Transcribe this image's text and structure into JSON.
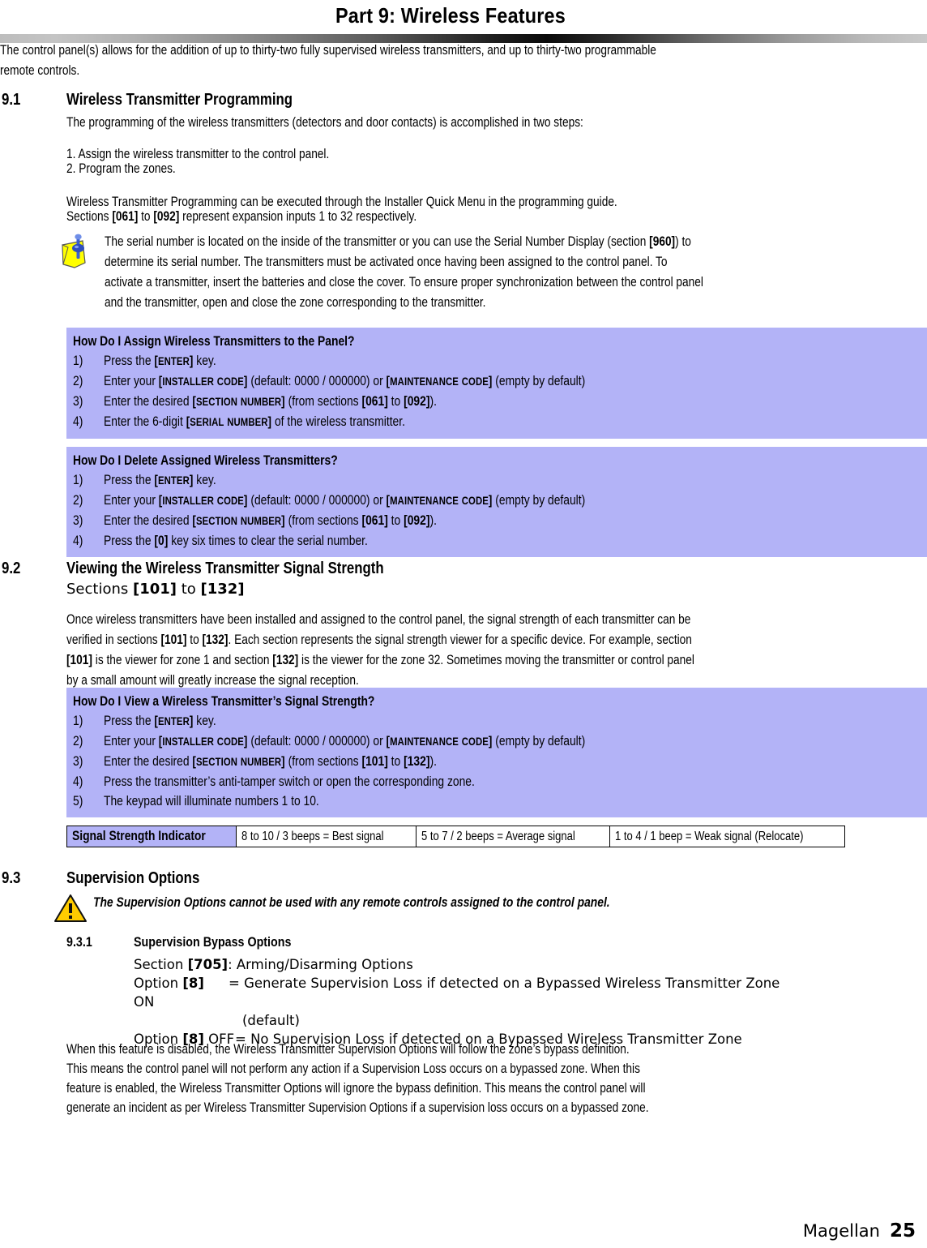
{
  "document": {
    "title": "Part 9: Wireless Features",
    "intro": "The control panel(s) allows for the addition of up to thirty-two fully supervised wireless transmitters, and up to thirty-two programmable remote controls.",
    "footer_brand": "Magellan",
    "footer_page": "25"
  },
  "section_91": {
    "number": "9.1",
    "title": "Wireless Transmitter Programming",
    "intro": "The programming of the wireless transmitters (detectors and door contacts) is accomplished in two steps:",
    "step1": "1. Assign the wireless transmitter to the control panel.",
    "step2": "2. Program the zones.",
    "para_line1": "Wireless Transmitter Programming can be executed through the Installer Quick Menu in the programming guide.",
    "para_line2_a": "Sections ",
    "para_line2_b": "[061]",
    "para_line2_c": " to ",
    "para_line2_d": "[092]",
    "para_line2_e": " represent expansion inputs 1 to 32 respectively."
  },
  "note": {
    "icon": "note-pushpin-icon",
    "line1_a": "The serial number is located on the inside of the transmitter or you can use the Serial Number Display (section ",
    "line1_b": "[960]",
    "line1_c": ") to",
    "line2": "determine its serial number. The transmitters must be activated once having been assigned to the control panel. To",
    "line3": "activate a transmitter, insert the batteries and close the cover. To ensure proper synchronization between the control panel",
    "line4": "and the transmitter, open and close the zone corresponding to the transmitter."
  },
  "box_assign": {
    "header": "How Do I Assign Wireless Transmitters to the Panel?",
    "rows": [
      {
        "num": "1)",
        "parts": [
          {
            "t": "Press the ",
            "s": "n"
          },
          {
            "t": "[ENTER]",
            "s": "k"
          },
          {
            "t": " key.",
            "s": "n"
          }
        ]
      },
      {
        "num": "2)",
        "parts": [
          {
            "t": "Enter your ",
            "s": "n"
          },
          {
            "t": "[INSTALLER CODE]",
            "s": "k"
          },
          {
            "t": " (default: 0000 / 000000) or ",
            "s": "n"
          },
          {
            "t": "[MAINTENANCE CODE]",
            "s": "k"
          },
          {
            "t": " (empty by default)",
            "s": "n"
          }
        ]
      },
      {
        "num": "3)",
        "parts": [
          {
            "t": "Enter the desired ",
            "s": "n"
          },
          {
            "t": "[SECTION NUMBER]",
            "s": "k"
          },
          {
            "t": " (from sections ",
            "s": "n"
          },
          {
            "t": "[061]",
            "s": "b"
          },
          {
            "t": " to ",
            "s": "n"
          },
          {
            "t": "[092]",
            "s": "b"
          },
          {
            "t": ").",
            "s": "n"
          }
        ]
      },
      {
        "num": "4)",
        "parts": [
          {
            "t": "Enter the 6-digit ",
            "s": "n"
          },
          {
            "t": "[SERIAL NUMBER]",
            "s": "k"
          },
          {
            "t": " of the wireless transmitter.",
            "s": "n"
          }
        ]
      }
    ]
  },
  "box_delete": {
    "header": "How Do I Delete Assigned Wireless Transmitters?",
    "rows": [
      {
        "num": "1)",
        "parts": [
          {
            "t": "Press the ",
            "s": "n"
          },
          {
            "t": "[ENTER]",
            "s": "k"
          },
          {
            "t": " key.",
            "s": "n"
          }
        ]
      },
      {
        "num": "2)",
        "parts": [
          {
            "t": "Enter your ",
            "s": "n"
          },
          {
            "t": "[INSTALLER CODE]",
            "s": "k"
          },
          {
            "t": " (default: 0000 / 000000) or ",
            "s": "n"
          },
          {
            "t": "[MAINTENANCE CODE]",
            "s": "k"
          },
          {
            "t": " (empty by default)",
            "s": "n"
          }
        ]
      },
      {
        "num": "3)",
        "parts": [
          {
            "t": "Enter the desired ",
            "s": "n"
          },
          {
            "t": "[SECTION NUMBER]",
            "s": "k"
          },
          {
            "t": " (from sections ",
            "s": "n"
          },
          {
            "t": "[061]",
            "s": "b"
          },
          {
            "t": " to ",
            "s": "n"
          },
          {
            "t": "[092]",
            "s": "b"
          },
          {
            "t": ").",
            "s": "n"
          }
        ]
      },
      {
        "num": "4)",
        "parts": [
          {
            "t": "Press the ",
            "s": "n"
          },
          {
            "t": "[0]",
            "s": "b"
          },
          {
            "t": " key six times to clear the serial number.",
            "s": "n"
          }
        ]
      }
    ]
  },
  "section_92": {
    "number": "9.2",
    "title": "Viewing the Wireless Transmitter Signal Strength",
    "subtitle_a": "Sections ",
    "subtitle_b": "[101]",
    "subtitle_c": " to ",
    "subtitle_d": "[132]",
    "para_line1": "Once wireless transmitters have been installed and assigned to the control panel, the signal strength of each transmitter can be",
    "para_line2_a": "verified in sections ",
    "para_line2_b": "[101]",
    "para_line2_c": " to ",
    "para_line2_d": "[132]",
    "para_line2_e": ". Each section represents the signal strength viewer for a specific device. For example, section",
    "para_line3_a": "[101]",
    "para_line3_b": " is the viewer for zone 1 and section ",
    "para_line3_c": "[132]",
    "para_line3_d": " is the viewer for the zone 32. Sometimes moving the transmitter or control panel",
    "para_line4": "by a small amount will greatly increase the signal reception."
  },
  "box_view": {
    "header": "How Do I View a Wireless Transmitter’s Signal Strength?",
    "rows": [
      {
        "num": "1)",
        "parts": [
          {
            "t": "Press the ",
            "s": "n"
          },
          {
            "t": "[ENTER]",
            "s": "k"
          },
          {
            "t": " key.",
            "s": "n"
          }
        ]
      },
      {
        "num": "2)",
        "parts": [
          {
            "t": "Enter your ",
            "s": "n"
          },
          {
            "t": "[INSTALLER CODE]",
            "s": "k"
          },
          {
            "t": " (default: 0000 / 000000) or ",
            "s": "n"
          },
          {
            "t": "[MAINTENANCE CODE]",
            "s": "k"
          },
          {
            "t": " (empty by default)",
            "s": "n"
          }
        ]
      },
      {
        "num": "3)",
        "parts": [
          {
            "t": "Enter the desired ",
            "s": "n"
          },
          {
            "t": "[SECTION NUMBER]",
            "s": "k"
          },
          {
            "t": " (from sections ",
            "s": "n"
          },
          {
            "t": "[101]",
            "s": "b"
          },
          {
            "t": " to ",
            "s": "n"
          },
          {
            "t": "[132]",
            "s": "b"
          },
          {
            "t": ").",
            "s": "n"
          }
        ]
      },
      {
        "num": "4)",
        "parts": [
          {
            "t": "Press the transmitter’s anti-tamper switch or open the corresponding zone.",
            "s": "n"
          }
        ]
      },
      {
        "num": "5)",
        "parts": [
          {
            "t": "The keypad will illuminate numbers 1 to 10.",
            "s": "n"
          }
        ]
      }
    ]
  },
  "signal_table": {
    "label": "Signal Strength Indicator",
    "cells": [
      "8 to 10 / 3 beeps = Best signal",
      "5 to 7 / 2 beeps = Average signal",
      "1 to 4 / 1 beep = Weak signal (Relocate)"
    ]
  },
  "section_93": {
    "number": "9.3",
    "title": "Supervision Options",
    "warning_icon": "warning-triangle-icon",
    "warning_text": "The Supervision Options cannot be used with any remote controls assigned to the control panel."
  },
  "section_931": {
    "number": "9.3.1",
    "title": "Supervision Bypass Options",
    "section_line_a": "Section ",
    "section_line_b": "[705]",
    "section_line_c": ": Arming/Disarming Options",
    "opt_on_a": "Option ",
    "opt_on_b": "[8]",
    "opt_on_c": " ON",
    "opt_on_d": "= Generate Supervision Loss if detected on a Bypassed Wireless Transmitter Zone",
    "opt_on_e": "(default)",
    "opt_off_a": "Option ",
    "opt_off_b": "[8]",
    "opt_off_c": " OFF",
    "opt_off_d": "= No Supervision Loss if detected on a Bypassed Wireless Transmitter Zone",
    "para_line1": "When this feature is disabled, the Wireless Transmitter Supervision Options will follow the zone’s bypass definition.",
    "para_line2": "This means the control panel will not perform any action if a Supervision Loss occurs on a bypassed zone. When this",
    "para_line3": "feature is enabled, the Wireless Transmitter Options will ignore the bypass definition. This means the control panel will",
    "para_line4": "generate an incident as per Wireless Transmitter Supervision Options if a supervision loss occurs on a bypassed zone."
  },
  "colors": {
    "box_blue": "#b3b3f7",
    "note_yellow": "#ffff00",
    "pin_blue": "#3a5fd0",
    "warn_yellow": "#ffcc00"
  }
}
